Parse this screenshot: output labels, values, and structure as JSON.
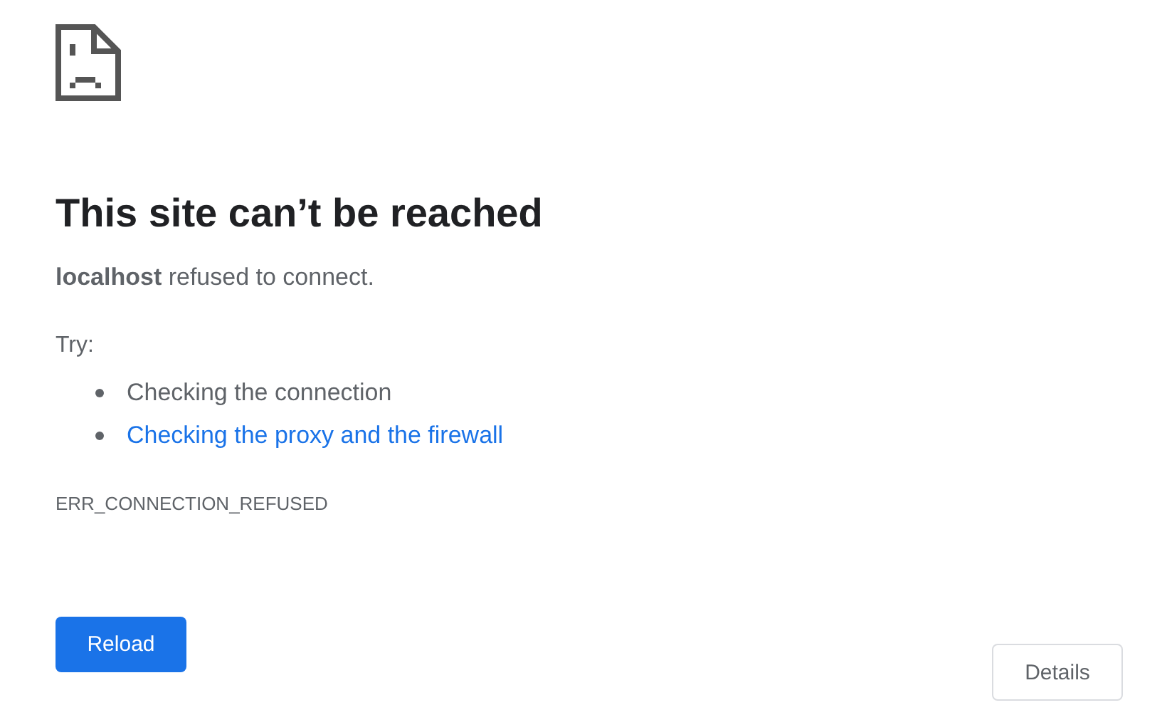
{
  "heading": "This site can’t be reached",
  "summary": "**localhost** refused to connect.",
  "try_label": "Try:",
  "suggestions": [
    {
      "kind": "text",
      "text": "Checking the connection"
    },
    {
      "kind": "link",
      "text": "Checking the proxy and the firewall"
    }
  ],
  "error_code": "ERR_CONNECTION_REFUSED",
  "buttons": {
    "primary": "Reload",
    "secondary": "Details"
  }
}
